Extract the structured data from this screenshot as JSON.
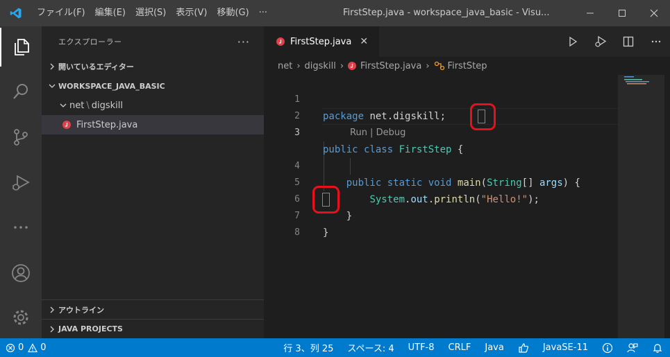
{
  "menu": [
    "ファイル(F)",
    "編集(E)",
    "選択(S)",
    "表示(V)",
    "移動(G)",
    "···"
  ],
  "window_title": "FirstStep.java - workspace_java_basic - Visu...",
  "sidebar": {
    "title": "エクスプローラー",
    "more": "···",
    "open_editors": "開いているエディター",
    "workspace": "WORKSPACE_JAVA_BASIC",
    "folder_part1": "net",
    "folder_sep": "\\",
    "folder_part2": "digskill",
    "file": "FirstStep.java",
    "outline": "アウトライン",
    "java_projects": "JAVA PROJECTS"
  },
  "tab": {
    "label": "FirstStep.java",
    "close": "✕"
  },
  "breadcrumb": {
    "p1": "net",
    "p2": "digskill",
    "p3": "FirstStep.java",
    "p4": "FirstStep"
  },
  "editor": {
    "line_numbers": [
      "1",
      "2",
      "3",
      "4",
      "5",
      "6",
      "7",
      "8"
    ],
    "codelens": "Run | Debug",
    "code": {
      "l1_kw": "package",
      "l1_rest": " net.digskill;",
      "l3_kw1": "public",
      "l3_kw2": " class",
      "l3_name": " FirstStep",
      "l3_brace": "{",
      "l4_kw1": "public",
      "l4_kw2": " static",
      "l4_kw3": " void",
      "l4_fn": " main",
      "l4_p1": "(",
      "l4_type": "String",
      "l4_p2": "[] ",
      "l4_var": "args",
      "l4_p3": ") {",
      "l5_type": "System",
      "l5_dot1": ".",
      "l5_var": "out",
      "l5_dot2": ".",
      "l5_fn": "println",
      "l5_p1": "(",
      "l5_str": "\"Hello!\"",
      "l5_p2": ");",
      "l6": "}",
      "l7": "}"
    }
  },
  "status": {
    "errors": "0",
    "warnings": "0",
    "position": "行 3、列 25",
    "spaces": "スペース: 4",
    "encoding": "UTF-8",
    "eol": "CRLF",
    "language": "Java",
    "runtime": "JavaSE-11"
  },
  "colors": {
    "accent": "#007acc",
    "highlight": "#e8111b"
  }
}
